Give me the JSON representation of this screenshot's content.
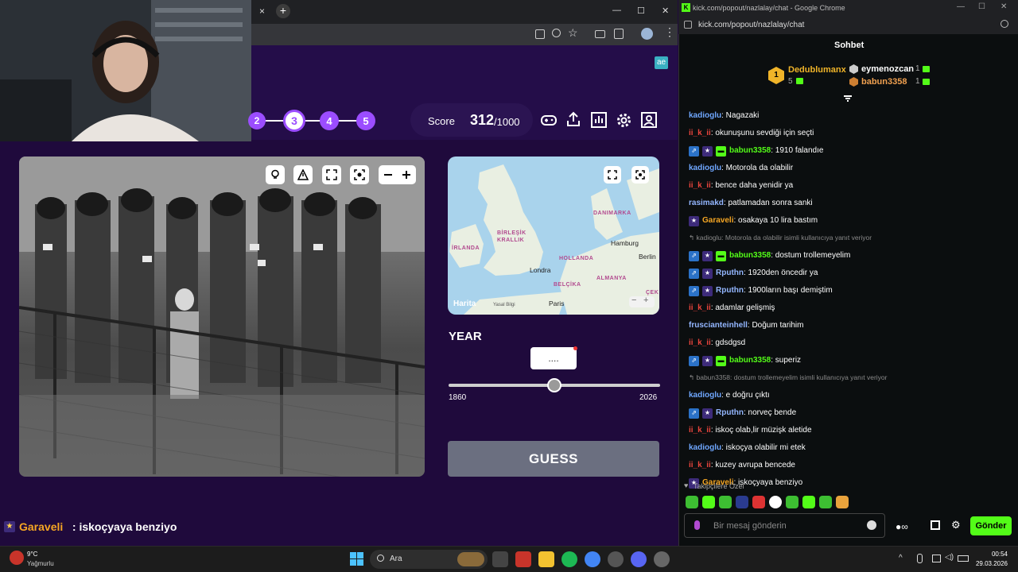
{
  "browser_left": {
    "tab_close": "×",
    "new_tab": "+",
    "win_min": "—",
    "win_max": "☐",
    "win_close": "✕"
  },
  "game": {
    "logo": "ae",
    "steps": [
      "2",
      "3",
      "4",
      "5"
    ],
    "active_step": "3",
    "score_label": "Score",
    "score_value": "312",
    "score_max": "/1000",
    "year_label": "YEAR",
    "year_value": "....",
    "slider_min": "1860",
    "slider_max": "2026",
    "slider_position": 0.5,
    "guess_button": "GUESS",
    "map": {
      "labels": [
        "BİRLEŞİK",
        "KRALLIK",
        "İRLANDA",
        "DANIMARKA",
        "HOLLANDA",
        "BELÇİKA",
        "ALMANYA",
        "ÇEK"
      ],
      "cities": [
        "Londra",
        "Paris",
        "Hamburg",
        "Berlin"
      ],
      "brand": "Harita",
      "legal": "Yasal Bilgi",
      "zoom_out": "−",
      "zoom_in": "+"
    },
    "overlay_user": "Garaveli",
    "overlay_text": " : iskoçyaya benziyo"
  },
  "chat_window": {
    "title": "kick.com/popout/nazlalay/chat - Google Chrome",
    "address": "kick.com/popout/nazlalay/chat",
    "header": "Sohbet",
    "leaderboard": {
      "first_rank": "1",
      "first_name": "Dedublumanx",
      "first_count": "5",
      "second_name": "eymenozcan",
      "second_count": "1",
      "third_name": "babun3358",
      "third_count": "1"
    },
    "messages": [
      {
        "user": "kadioglu",
        "text": ": Nagazaki",
        "color": "blue",
        "badges": []
      },
      {
        "user": "ii_k_ii",
        "text": ": okunuşunu sevdiği için seçti",
        "color": "red",
        "badges": []
      },
      {
        "user": "babun3358",
        "text": ": 1910 falandıe",
        "color": "green",
        "badges": [
          "blue",
          "purple",
          "green"
        ]
      },
      {
        "user": "kadioglu",
        "text": ": Motorola da olabilir",
        "color": "blue",
        "badges": []
      },
      {
        "user": "ii_k_ii",
        "text": ": bence daha yenidir ya",
        "color": "red",
        "badges": []
      },
      {
        "user": "rasimakd",
        "text": ": patlamadan sonra sanki",
        "color": "lblue",
        "badges": []
      },
      {
        "user": "Garaveli",
        "text": ": osakaya 10 lira bastım",
        "color": "orange",
        "badges": [
          "purple"
        ]
      },
      {
        "reply": "kadioglu: Motorola da olabilir isimli kullanıcıya yanıt veriyor"
      },
      {
        "user": "babun3358",
        "text": ": dostum trollemeyelim",
        "color": "green",
        "badges": [
          "blue",
          "purple",
          "green"
        ]
      },
      {
        "user": "Rputhn",
        "text": ": 1920den öncedir ya",
        "color": "lblue",
        "badges": [
          "blue",
          "purple"
        ]
      },
      {
        "user": "Rputhn",
        "text": ": 1900ların başı demiştim",
        "color": "lblue",
        "badges": [
          "blue",
          "purple"
        ]
      },
      {
        "user": "ii_k_ii",
        "text": ": adamlar gelişmiş",
        "color": "red",
        "badges": []
      },
      {
        "user": "fruscianteinhell",
        "text": ": Doğum tarihim",
        "color": "lblue",
        "badges": []
      },
      {
        "user": "ii_k_ii",
        "text": ": gdsdgsd",
        "color": "red",
        "badges": []
      },
      {
        "user": "babun3358",
        "text": ": superiz",
        "color": "green",
        "badges": [
          "blue",
          "purple",
          "green"
        ]
      },
      {
        "reply": "babun3358: dostum trollemeyelim isimli kullanıcıya yanıt veriyor"
      },
      {
        "user": "kadioglu",
        "text": ": e doğru çıktı",
        "color": "blue",
        "badges": []
      },
      {
        "user": "Rputhn",
        "text": ": norveç bende",
        "color": "lblue",
        "badges": [
          "blue",
          "purple"
        ]
      },
      {
        "user": "ii_k_ii",
        "text": ": iskoç olab,lir müzişk aletide",
        "color": "red",
        "badges": []
      },
      {
        "user": "kadioglu",
        "text": ": iskoçya olabilir mi etek",
        "color": "blue",
        "badges": []
      },
      {
        "user": "ii_k_ii",
        "text": ": kuzey avrupa bencede",
        "color": "red",
        "badges": []
      },
      {
        "user": "Garaveli",
        "text": ": iskoçyaya benziyo",
        "color": "orange",
        "badges": [
          "purple"
        ]
      }
    ],
    "followers_only": "Takipçilere Özel",
    "input_placeholder": "Bir mesaj gönderin",
    "send_button": "Gönder"
  },
  "taskbar": {
    "weather_temp": "9°C",
    "weather_desc": "Yağmurlu",
    "search": "Ara",
    "time": "00:54",
    "date": "29.03.2026"
  },
  "colors": {
    "accent_green": "#53fc18",
    "game_bg": "#1f0a3c",
    "step_purple": "#9b4dff"
  }
}
